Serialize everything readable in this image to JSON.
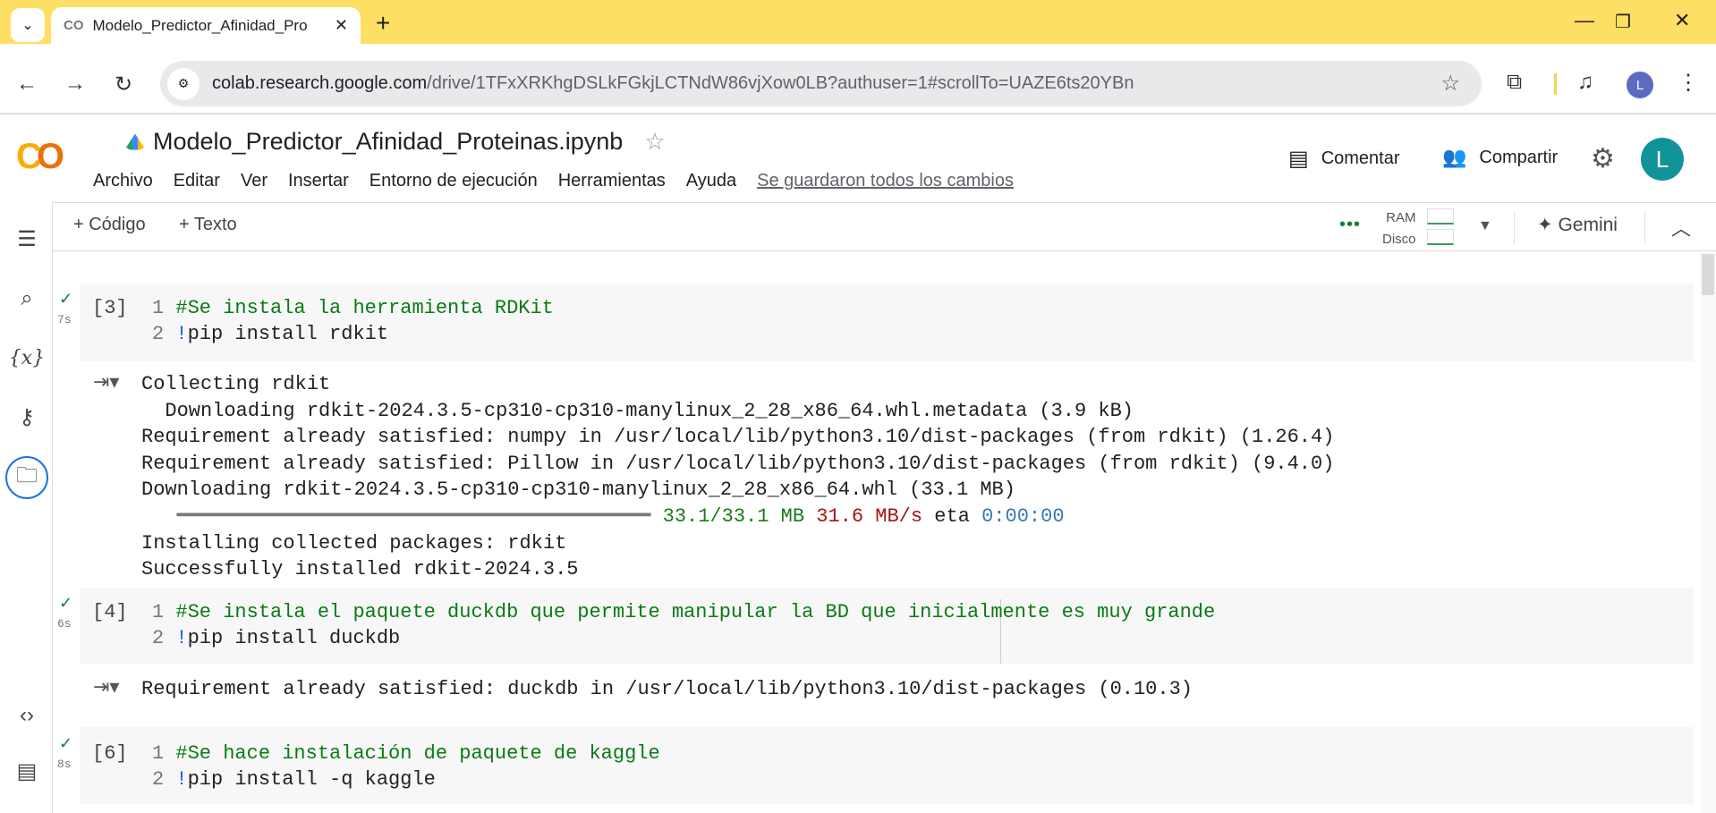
{
  "browser": {
    "tab_title": "Modelo_Predictor_Afinidad_Pro",
    "url_host": "colab.research.google.com",
    "url_path": "/drive/1TFxXRKhgDSLkFGkjLCTNdW86vjXow0LB?authuser=1#scrollTo=UAZE6ts20YBn",
    "profile_initial": "L"
  },
  "header": {
    "title": "Modelo_Predictor_Afinidad_Proteinas.ipynb",
    "menu": [
      "Archivo",
      "Editar",
      "Ver",
      "Insertar",
      "Entorno de ejecución",
      "Herramientas",
      "Ayuda"
    ],
    "saved_status": "Se guardaron todos los cambios",
    "comment": "Comentar",
    "share": "Compartir",
    "user_initial": "L"
  },
  "toolbar": {
    "add_code": "+ Código",
    "add_text": "+ Texto",
    "ram": "RAM",
    "disk": "Disco",
    "gemini": "Gemini"
  },
  "cells": [
    {
      "exec": "[3]",
      "time": "7s",
      "lines": [
        {
          "n": "1",
          "code": "#Se instala la herramienta RDKit",
          "comment": true
        },
        {
          "n": "2",
          "code": "pip install rdkit",
          "comment": false
        }
      ],
      "output": [
        "Collecting rdkit",
        "  Downloading rdkit-2024.3.5-cp310-cp310-manylinux_2_28_x86_64.whl.metadata (3.9 kB)",
        "Requirement already satisfied: numpy in /usr/local/lib/python3.10/dist-packages (from rdkit) (1.26.4)",
        "Requirement already satisfied: Pillow in /usr/local/lib/python3.10/dist-packages (from rdkit) (9.4.0)",
        "Downloading rdkit-2024.3.5-cp310-cp310-manylinux_2_28_x86_64.whl (33.1 MB)"
      ],
      "progress": {
        "bar": "   ━━━━━━━━━━━━━━━━━━━━━━━━━━━━━━━━━━━━━━━━ ",
        "size": "33.1/33.1 MB",
        "speed": "31.6 MB/s",
        "eta_label": " eta ",
        "eta": "0:00:00",
        "percent": 100
      },
      "output_tail": [
        "Installing collected packages: rdkit",
        "Successfully installed rdkit-2024.3.5"
      ]
    },
    {
      "exec": "[4]",
      "time": "6s",
      "lines": [
        {
          "n": "1",
          "code": "#Se instala el paquete duckdb que permite manipular la BD que inicialmente es muy grande"
        },
        {
          "n": "2",
          "code": "pip install duckdb"
        }
      ],
      "output": [
        "Requirement already satisfied: duckdb in /usr/local/lib/python3.10/dist-packages (0.10.3)"
      ]
    },
    {
      "exec": "[6]",
      "time": "8s",
      "lines": [
        {
          "n": "1",
          "code": "#Se hace instalación de paquete de kaggle"
        },
        {
          "n": "2",
          "code": "pip install -q kaggle"
        }
      ]
    }
  ],
  "colors": {
    "tabbar": "#fddf63",
    "comment": "#0a7a16",
    "avatar_header": "#12939a",
    "avatar_browser": "#5c6bc0"
  }
}
